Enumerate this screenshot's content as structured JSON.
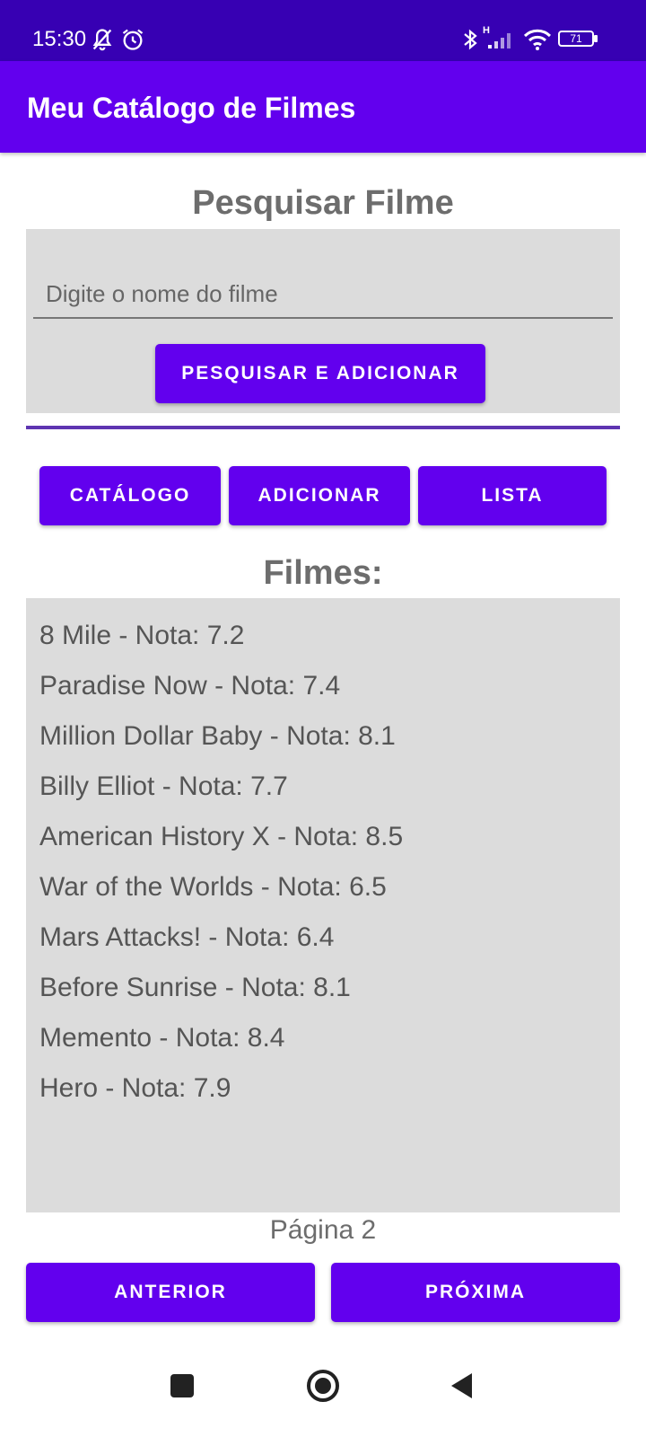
{
  "status_bar": {
    "time": "15:30",
    "battery": "71",
    "network": "H",
    "icons": [
      "bell-off-icon",
      "alarm-icon",
      "bluetooth-icon",
      "signal-icon",
      "wifi-icon",
      "battery-icon"
    ]
  },
  "app_bar": {
    "title": "Meu Catálogo de Filmes"
  },
  "search": {
    "heading": "Pesquisar Filme",
    "placeholder": "Digite o nome do filme",
    "value": "",
    "button_label": "PESQUISAR E ADICIONAR"
  },
  "tabs": [
    {
      "label": "CATÁLOGO"
    },
    {
      "label": "ADICIONAR"
    },
    {
      "label": "LISTA"
    }
  ],
  "movies": {
    "heading": "Filmes:",
    "items": [
      "8 Mile - Nota: 7.2",
      "Paradise Now - Nota: 7.4",
      "Million Dollar Baby - Nota: 8.1",
      "Billy Elliot - Nota: 7.7",
      "American History X - Nota: 8.5",
      "War of the Worlds - Nota: 6.5",
      "Mars Attacks! - Nota: 6.4",
      "Before Sunrise - Nota: 8.1",
      "Memento - Nota: 8.4",
      "Hero - Nota: 7.9"
    ]
  },
  "pagination": {
    "page_label": "Página 2",
    "prev_label": "ANTERIOR",
    "next_label": "PRÓXIMA"
  },
  "nav_bar": {
    "icons": [
      "recents-square-icon",
      "home-circle-icon",
      "back-triangle-icon"
    ]
  },
  "colors": {
    "primary": "#6200ee",
    "primary_dark": "#3700b3",
    "divider": "#5e35b1",
    "panel": "#dcdcdc"
  }
}
